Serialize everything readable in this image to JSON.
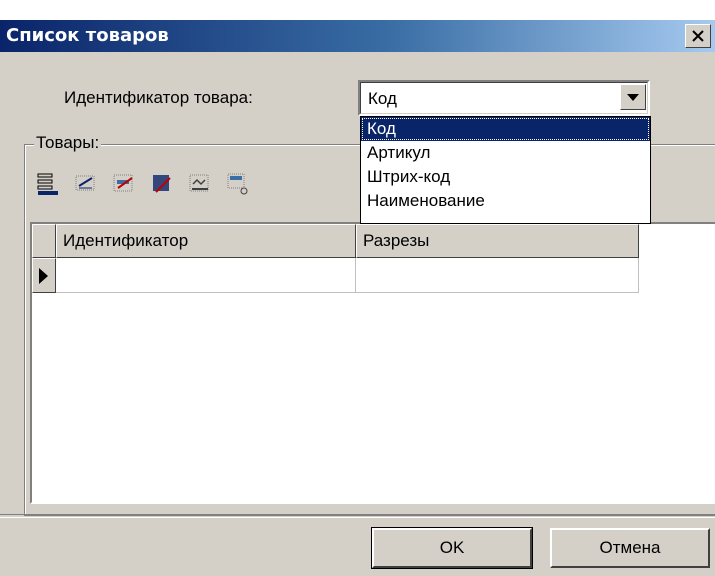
{
  "window": {
    "title": "Список товаров"
  },
  "identifier": {
    "label": "Идентификатор товара:",
    "selected": "Код",
    "options": [
      "Код",
      "Артикул",
      "Штрих-код",
      "Наименование"
    ]
  },
  "group": {
    "label": "Товары:"
  },
  "toolbar": {
    "tools": [
      "add-row-icon",
      "edit-row-icon",
      "delete-row-icon",
      "delete-all-icon",
      "select-icon",
      "import-icon"
    ]
  },
  "grid": {
    "columns": [
      "Идентификатор",
      "Разрезы"
    ],
    "rows": [
      [
        "",
        ""
      ]
    ]
  },
  "buttons": {
    "ok": "OK",
    "cancel": "Отмена"
  }
}
